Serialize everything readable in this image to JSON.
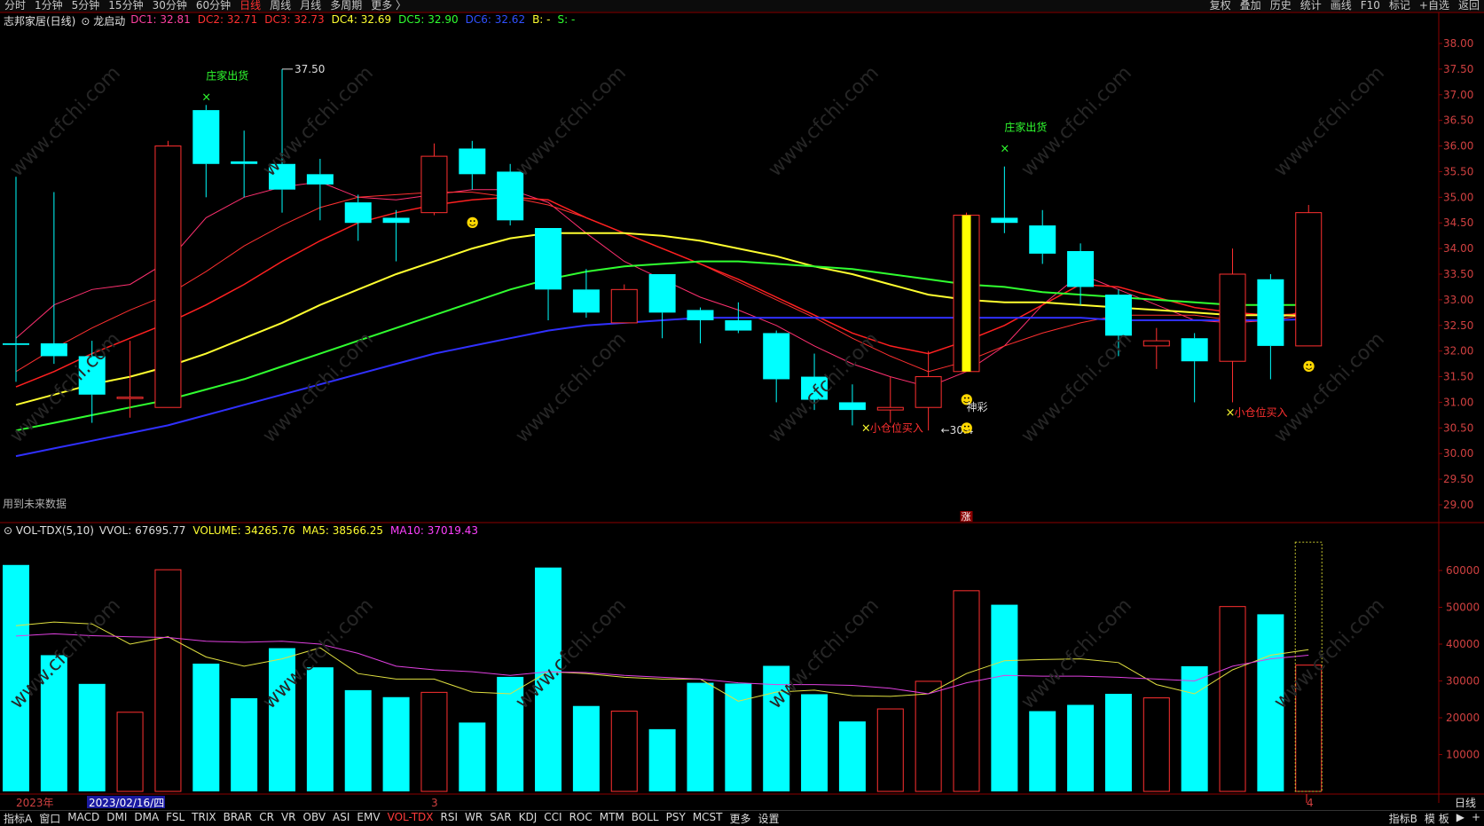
{
  "toolbar": {
    "left": [
      "分时",
      "1分钟",
      "5分钟",
      "15分钟",
      "30分钟",
      "60分钟",
      "日线",
      "周线",
      "月线",
      "多周期",
      "更多 〉"
    ],
    "active": "日线",
    "right": [
      "复权",
      "叠加",
      "历史",
      "统计",
      "画线",
      "F10",
      "标记",
      "+自选",
      "返回"
    ]
  },
  "main_header": {
    "stock": "志邦家居(日线)",
    "indicator": "龙启动",
    "items": [
      {
        "text": "DC1: 32.81",
        "color": "#ff40a0"
      },
      {
        "text": "DC2: 32.71",
        "color": "#ff3030"
      },
      {
        "text": "DC3: 32.73",
        "color": "#ff3030"
      },
      {
        "text": "DC4: 32.69",
        "color": "#ffff30"
      },
      {
        "text": "DC5: 32.90",
        "color": "#30ff30"
      },
      {
        "text": "DC6: 32.62",
        "color": "#3050ff"
      },
      {
        "text": "B: -",
        "color": "#ffff30"
      },
      {
        "text": "S: -",
        "color": "#30ff30"
      }
    ]
  },
  "vol_header": {
    "name": "VOL-TDX(5,10)",
    "items": [
      {
        "text": "VVOL: 67695.77",
        "color": "#dddddd"
      },
      {
        "text": "VOLUME: 34265.76",
        "color": "#ffff30"
      },
      {
        "text": "MA5: 38566.25",
        "color": "#ffff30"
      },
      {
        "text": "MA10: 37019.43",
        "color": "#ff40ff"
      }
    ]
  },
  "annotations": {
    "sell_signal": "庄家出货",
    "buy_signal": "小仓位买入",
    "high_label": "37.50",
    "low_label": "30.4",
    "shencai": "神彩",
    "future_note": "用到未来数据",
    "zhang": "涨"
  },
  "bottom_dates": [
    "2023年",
    "2023/02/16/四",
    "3",
    "4"
  ],
  "period_label": "日线",
  "bottom_tabs": [
    "指标A",
    "窗口",
    "MACD",
    "DMI",
    "DMA",
    "FSL",
    "TRIX",
    "BRAR",
    "CR",
    "VR",
    "OBV",
    "ASI",
    "EMV",
    "VOL-TDX",
    "RSI",
    "WR",
    "SAR",
    "KDJ",
    "CCI",
    "ROC",
    "MTM",
    "BOLL",
    "PSY",
    "MCST",
    "更多",
    "设置"
  ],
  "bottom_active": "VOL-TDX",
  "bottom_right": [
    "指标B",
    "模 板",
    "▶",
    "+"
  ],
  "colors": {
    "up": "#ff3030",
    "down": "#00ffff",
    "bg": "#000000",
    "grid": "#8b0000"
  },
  "chart_data": {
    "type": "candlestick",
    "price_axis": {
      "min": 29.0,
      "max": 38.0,
      "ticks": [
        "38.00",
        "37.50",
        "37.00",
        "36.50",
        "36.00",
        "35.50",
        "35.00",
        "34.50",
        "34.00",
        "33.50",
        "33.00",
        "32.50",
        "32.00",
        "31.50",
        "31.00",
        "30.50",
        "30.00",
        "29.50",
        "29.00"
      ]
    },
    "volume_axis": {
      "min": 0,
      "max": 60000,
      "ticks": [
        "60000",
        "50000",
        "40000",
        "30000",
        "20000",
        "10000"
      ]
    },
    "candles": [
      {
        "o": 32.15,
        "c": 32.12,
        "h": 35.4,
        "l": 31.4
      },
      {
        "o": 32.15,
        "c": 31.9,
        "h": 35.1,
        "l": 31.75
      },
      {
        "o": 31.9,
        "c": 31.15,
        "h": 32.2,
        "l": 30.6
      },
      {
        "o": 31.1,
        "c": 31.1,
        "h": 32.2,
        "l": 30.7
      },
      {
        "o": 30.9,
        "c": 36.0,
        "h": 36.1,
        "l": 30.9
      },
      {
        "o": 36.7,
        "c": 35.65,
        "h": 36.8,
        "l": 35.0
      },
      {
        "o": 35.7,
        "c": 35.65,
        "h": 36.3,
        "l": 35.0
      },
      {
        "o": 35.65,
        "c": 35.15,
        "h": 37.5,
        "l": 34.7
      },
      {
        "o": 35.45,
        "c": 35.25,
        "h": 35.75,
        "l": 34.55
      },
      {
        "o": 34.9,
        "c": 34.5,
        "h": 35.05,
        "l": 34.15
      },
      {
        "o": 34.6,
        "c": 34.5,
        "h": 34.75,
        "l": 33.75
      },
      {
        "o": 34.7,
        "c": 35.8,
        "h": 36.05,
        "l": 34.65
      },
      {
        "o": 35.95,
        "c": 35.45,
        "h": 36.1,
        "l": 35.15
      },
      {
        "o": 35.5,
        "c": 34.55,
        "h": 35.65,
        "l": 34.45
      },
      {
        "o": 34.4,
        "c": 33.2,
        "h": 34.4,
        "l": 32.6
      },
      {
        "o": 33.2,
        "c": 32.75,
        "h": 33.6,
        "l": 32.65
      },
      {
        "o": 32.55,
        "c": 33.2,
        "h": 33.3,
        "l": 32.55
      },
      {
        "o": 33.5,
        "c": 32.75,
        "h": 33.5,
        "l": 32.25
      },
      {
        "o": 32.8,
        "c": 32.6,
        "h": 32.85,
        "l": 32.15
      },
      {
        "o": 32.6,
        "c": 32.4,
        "h": 32.95,
        "l": 32.35
      },
      {
        "o": 32.35,
        "c": 31.45,
        "h": 32.4,
        "l": 31.0
      },
      {
        "o": 31.5,
        "c": 31.05,
        "h": 31.95,
        "l": 30.85
      },
      {
        "o": 31.0,
        "c": 30.85,
        "h": 31.35,
        "l": 30.55
      },
      {
        "o": 30.85,
        "c": 30.9,
        "h": 31.5,
        "l": 30.6
      },
      {
        "o": 30.9,
        "c": 31.5,
        "h": 32.0,
        "l": 30.45
      },
      {
        "o": 31.6,
        "c": 34.65,
        "h": 34.7,
        "l": 31.6
      },
      {
        "o": 34.6,
        "c": 34.5,
        "h": 35.6,
        "l": 34.3
      },
      {
        "o": 34.45,
        "c": 33.9,
        "h": 34.75,
        "l": 33.7
      },
      {
        "o": 33.95,
        "c": 33.25,
        "h": 34.1,
        "l": 32.9
      },
      {
        "o": 33.1,
        "c": 32.3,
        "h": 33.2,
        "l": 31.9
      },
      {
        "o": 32.1,
        "c": 32.2,
        "h": 32.45,
        "l": 31.65
      },
      {
        "o": 32.25,
        "c": 31.8,
        "h": 32.35,
        "l": 31.0
      },
      {
        "o": 31.8,
        "c": 33.5,
        "h": 34.0,
        "l": 31.0
      },
      {
        "o": 33.4,
        "c": 32.1,
        "h": 33.5,
        "l": 31.45
      },
      {
        "o": 32.1,
        "c": 34.7,
        "h": 34.85,
        "l": 32.1
      }
    ],
    "volume": [
      61500,
      37000,
      29200,
      21500,
      60200,
      34700,
      25300,
      38900,
      33700,
      27500,
      25600,
      26900,
      18700,
      31100,
      60800,
      23200,
      21800,
      16900,
      29500,
      29300,
      34100,
      26400,
      19000,
      22400,
      29900,
      54500,
      50700,
      21800,
      23500,
      26500,
      25400,
      34000,
      50200,
      48100,
      34300
    ],
    "vol_ma5": [
      45000,
      46000,
      45500,
      40000,
      42000,
      36500,
      34000,
      36000,
      39000,
      32000,
      30500,
      30500,
      27000,
      26500,
      32500,
      32000,
      31000,
      30500,
      30500,
      24500,
      27000,
      27500,
      26000,
      25800,
      26500,
      32000,
      35500,
      35800,
      36000,
      35000,
      29000,
      26500,
      33000,
      37000,
      38500
    ],
    "vol_ma10": [
      42200,
      42800,
      42300,
      42000,
      41800,
      40800,
      40500,
      40800,
      40000,
      37500,
      34000,
      33000,
      32500,
      31500,
      32500,
      32300,
      31500,
      31000,
      30500,
      29500,
      29000,
      29000,
      28800,
      28000,
      26500,
      29500,
      31500,
      31300,
      31300,
      31000,
      30500,
      30000,
      34000,
      36000,
      37000
    ],
    "ma_lines": [
      {
        "name": "DC1",
        "color": "#ff3070",
        "width": 1,
        "values": [
          32.25,
          32.9,
          33.2,
          33.3,
          33.75,
          34.6,
          35.0,
          35.2,
          35.3,
          35.0,
          34.95,
          35.05,
          35.15,
          35.15,
          34.9,
          34.3,
          33.75,
          33.4,
          33.05,
          32.8,
          32.5,
          32.1,
          31.75,
          31.5,
          31.3,
          31.6,
          32.1,
          32.9,
          33.5,
          33.2,
          32.9,
          32.6,
          32.55,
          32.6,
          32.81
        ]
      },
      {
        "name": "DC2",
        "color": "#ff3030",
        "width": 1,
        "values": [
          31.6,
          32.05,
          32.45,
          32.8,
          33.1,
          33.55,
          34.05,
          34.45,
          34.8,
          35.0,
          35.05,
          35.1,
          35.1,
          35.0,
          34.85,
          34.6,
          34.3,
          34.0,
          33.7,
          33.35,
          33.0,
          32.65,
          32.25,
          31.9,
          31.6,
          31.8,
          32.1,
          32.35,
          32.55,
          32.7,
          32.7,
          32.7,
          32.6,
          32.6,
          32.71
        ]
      },
      {
        "name": "DC3",
        "color": "#ff2020",
        "width": 1.5,
        "values": [
          31.3,
          31.6,
          31.95,
          32.25,
          32.55,
          32.9,
          33.3,
          33.75,
          34.15,
          34.5,
          34.7,
          34.85,
          34.95,
          35.0,
          34.95,
          34.6,
          34.3,
          34.0,
          33.7,
          33.4,
          33.05,
          32.7,
          32.35,
          32.1,
          31.95,
          32.2,
          32.5,
          32.9,
          33.3,
          33.25,
          33.05,
          32.85,
          32.75,
          32.7,
          32.73
        ]
      },
      {
        "name": "DC4",
        "color": "#ffff30",
        "width": 2,
        "values": [
          30.95,
          31.15,
          31.35,
          31.5,
          31.7,
          31.95,
          32.25,
          32.55,
          32.9,
          33.2,
          33.5,
          33.75,
          34.0,
          34.2,
          34.3,
          34.3,
          34.3,
          34.25,
          34.15,
          34.0,
          33.85,
          33.65,
          33.5,
          33.3,
          33.1,
          33.0,
          32.95,
          32.95,
          32.9,
          32.85,
          32.8,
          32.75,
          32.7,
          32.7,
          32.69
        ]
      },
      {
        "name": "DC5",
        "color": "#30ff30",
        "width": 2,
        "values": [
          30.45,
          30.6,
          30.75,
          30.9,
          31.05,
          31.25,
          31.45,
          31.7,
          31.95,
          32.2,
          32.45,
          32.7,
          32.95,
          33.2,
          33.4,
          33.55,
          33.65,
          33.7,
          33.75,
          33.75,
          33.7,
          33.65,
          33.6,
          33.5,
          33.4,
          33.3,
          33.25,
          33.15,
          33.1,
          33.05,
          33.0,
          32.95,
          32.9,
          32.9,
          32.9
        ]
      },
      {
        "name": "DC6",
        "color": "#3030ff",
        "width": 2,
        "values": [
          29.95,
          30.1,
          30.25,
          30.4,
          30.55,
          30.75,
          30.95,
          31.15,
          31.35,
          31.55,
          31.75,
          31.95,
          32.1,
          32.25,
          32.4,
          32.5,
          32.55,
          32.6,
          32.65,
          32.65,
          32.65,
          32.65,
          32.65,
          32.65,
          32.65,
          32.65,
          32.65,
          32.65,
          32.65,
          32.6,
          32.6,
          32.6,
          32.6,
          32.6,
          32.62
        ]
      }
    ]
  }
}
